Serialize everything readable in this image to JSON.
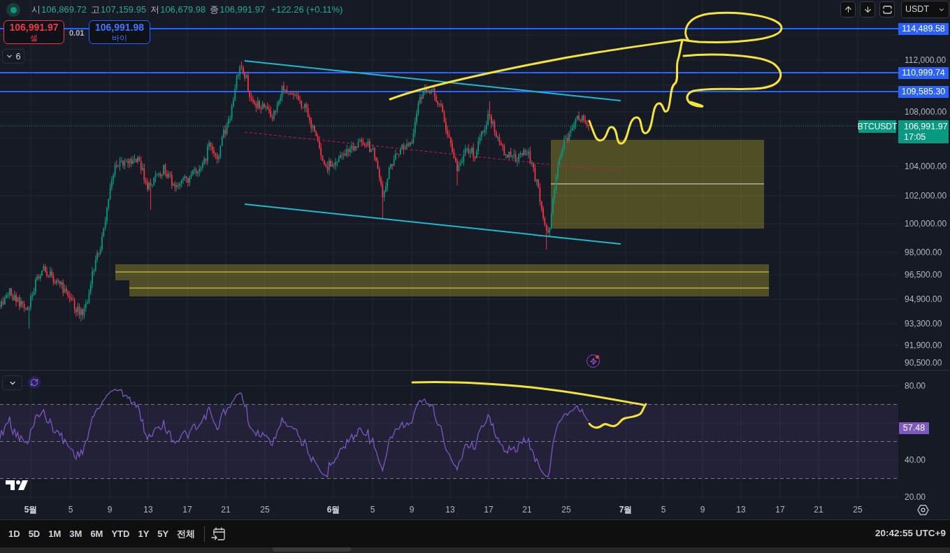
{
  "header": {
    "ohlc": [
      {
        "label": "시",
        "value": "106,869.72"
      },
      {
        "label": "고",
        "value": "107,159.95"
      },
      {
        "label": "저",
        "value": "106,679.98"
      },
      {
        "label": "종",
        "value": "106,991.97"
      }
    ],
    "change": "+122.26 (+0.11%)"
  },
  "trade": {
    "sell": {
      "price": "106,991.97",
      "label": "셀"
    },
    "spread": "0.01",
    "buy": {
      "price": "106,991.98",
      "label": "바이"
    }
  },
  "indicator_toggle": {
    "count": "6"
  },
  "top_right": {
    "currency": "USDT"
  },
  "price_axis": {
    "labels": [
      "112,000.00",
      "108,000.00",
      "104,000.00",
      "102,000.00",
      "100,000.00",
      "98,000.00",
      "96,500.00",
      "94,900.00",
      "93,300.00",
      "91,900.00",
      "90,500.00"
    ]
  },
  "price_lines": [
    "114,489.58",
    "110,999.74",
    "109,585.30"
  ],
  "last_price": {
    "symbol": "BTCUSDT",
    "price": "106,991.97",
    "countdown": "17:05"
  },
  "rsi": {
    "axis_labels": [
      "80.00",
      "40.00",
      "20.00"
    ],
    "value": "57.48"
  },
  "time_axis": {
    "labels": [
      {
        "label": "5월",
        "kind": "month"
      },
      {
        "label": "5",
        "kind": "day"
      },
      {
        "label": "9",
        "kind": "day"
      },
      {
        "label": "13",
        "kind": "day"
      },
      {
        "label": "17",
        "kind": "day"
      },
      {
        "label": "21",
        "kind": "day"
      },
      {
        "label": "25",
        "kind": "day"
      },
      {
        "label": "6월",
        "kind": "month"
      },
      {
        "label": "5",
        "kind": "day"
      },
      {
        "label": "9",
        "kind": "day"
      },
      {
        "label": "13",
        "kind": "day"
      },
      {
        "label": "17",
        "kind": "day"
      },
      {
        "label": "21",
        "kind": "day"
      },
      {
        "label": "25",
        "kind": "day"
      },
      {
        "label": "7월",
        "kind": "month"
      },
      {
        "label": "5",
        "kind": "day"
      },
      {
        "label": "9",
        "kind": "day"
      },
      {
        "label": "13",
        "kind": "day"
      },
      {
        "label": "17",
        "kind": "day"
      },
      {
        "label": "21",
        "kind": "day"
      },
      {
        "label": "25",
        "kind": "day"
      }
    ]
  },
  "range_bar": {
    "ranges": [
      "1D",
      "5D",
      "1M",
      "3M",
      "6M",
      "YTD",
      "1Y",
      "5Y",
      "전체"
    ],
    "clock": "20:42:55 UTC+9"
  }
}
